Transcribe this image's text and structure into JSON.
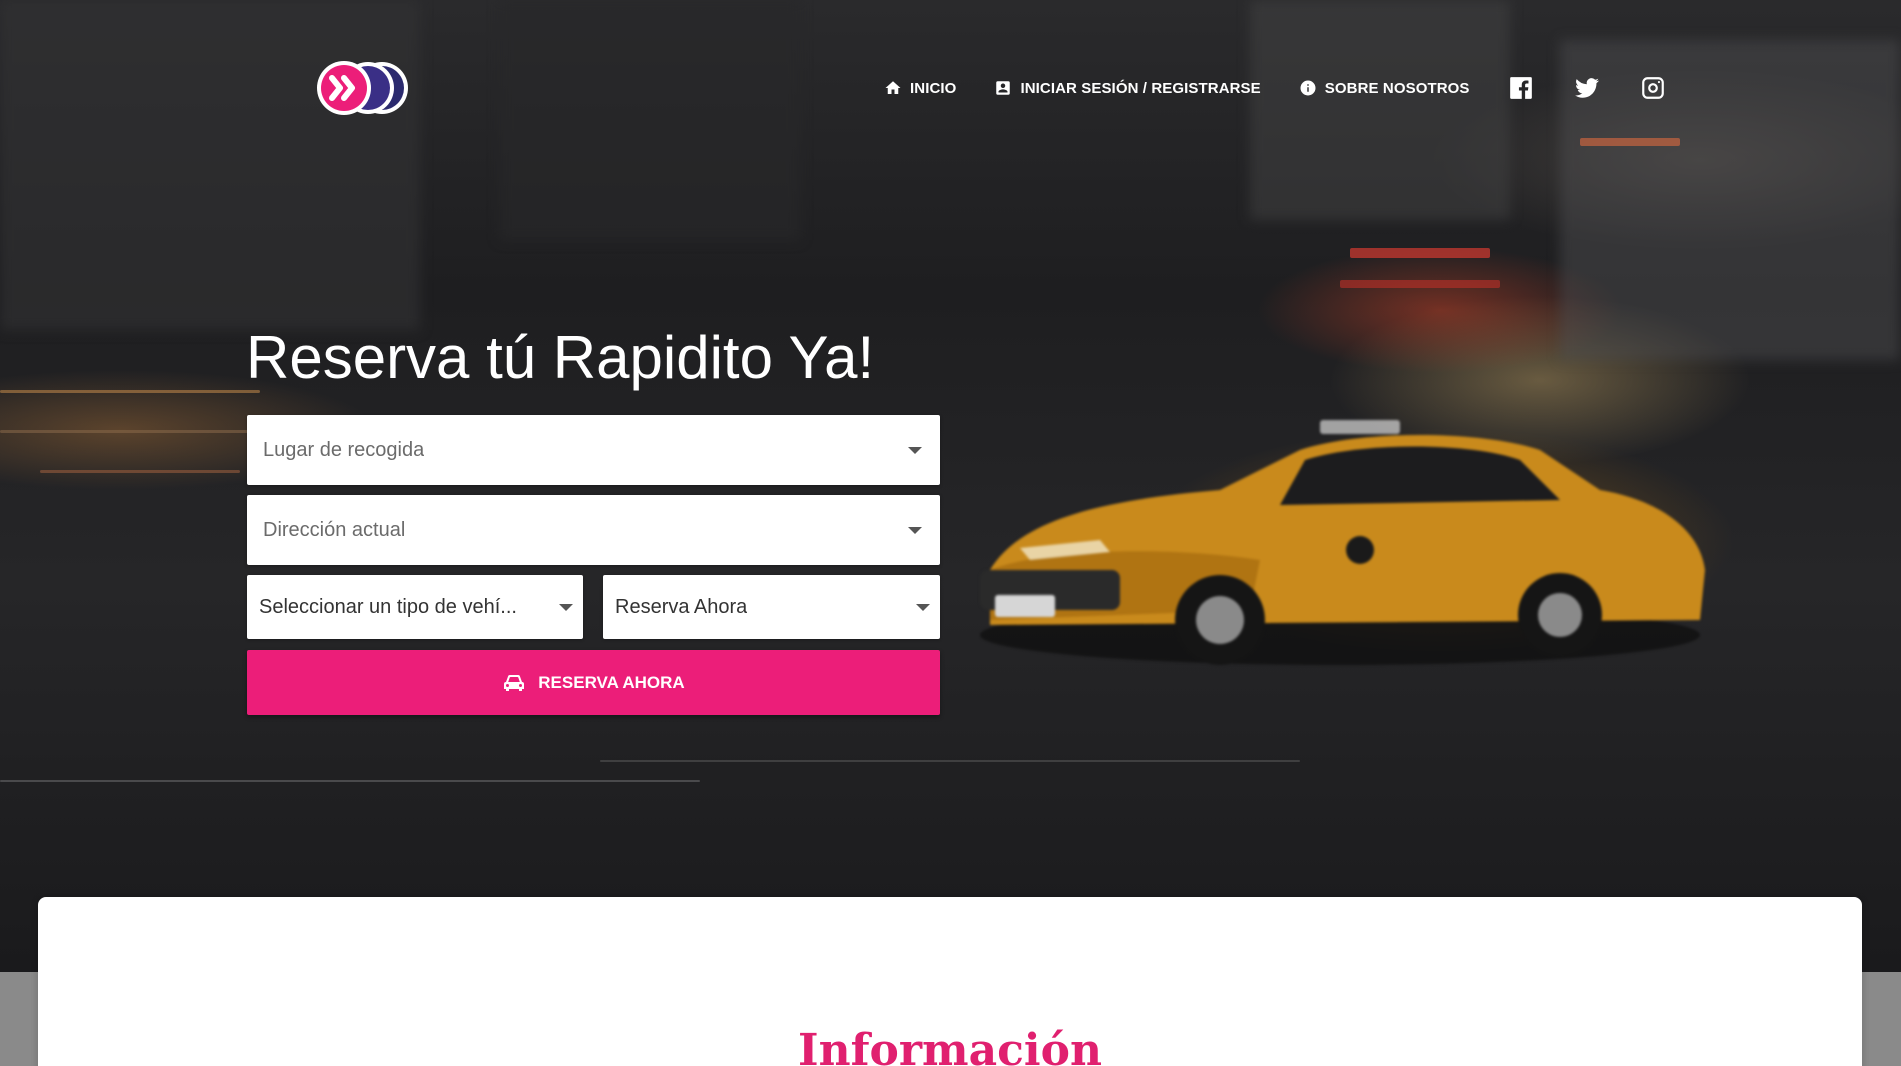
{
  "nav": {
    "items": [
      {
        "label": "INICIO",
        "icon": "home-icon"
      },
      {
        "label": "INICIAR SESIÓN / REGISTRARSE",
        "icon": "account-box-icon"
      },
      {
        "label": "SOBRE NOSOTROS",
        "icon": "info-icon"
      }
    ],
    "social": [
      "facebook-icon",
      "twitter-icon",
      "instagram-icon"
    ]
  },
  "hero": {
    "title": "Reserva tú Rapidito Ya!",
    "pickup_placeholder": "Lugar de recogida",
    "current_address_placeholder": "Dirección actual",
    "vehicle_type_value": "Seleccionar un tipo de vehí...",
    "booking_time_value": "Reserva Ahora",
    "submit_label": "RESERVA AHORA",
    "submit_icon": "car-icon"
  },
  "info": {
    "title": "Información"
  },
  "colors": {
    "accent": "#ec1e79",
    "logo_navy": "#2b2a6e",
    "info_title": "#e0206f"
  }
}
